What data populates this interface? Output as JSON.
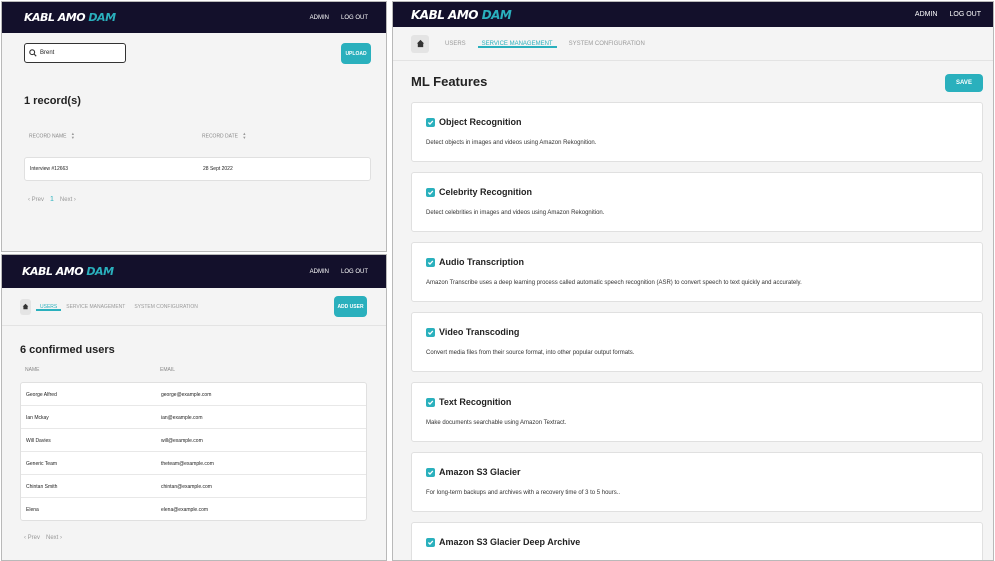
{
  "app": {
    "logo_main": "KABL AMO",
    "logo_accent": "DAM"
  },
  "nav": {
    "admin": "ADMIN",
    "logout": "LOG OUT"
  },
  "records_view": {
    "search_value": "Brent",
    "upload_label": "UPLOAD",
    "count_text": "1 record(s)",
    "columns": {
      "name": "RECORD NAME",
      "date": "RECORD DATE"
    },
    "rows": [
      {
        "name": "Interview #12663",
        "date": "28 Sept 2022"
      }
    ],
    "pagination": {
      "prev": "Prev",
      "page": "1",
      "next": "Next"
    }
  },
  "users_view": {
    "tabs": {
      "users": "USERS",
      "service": "SERVICE MANAGEMENT",
      "system": "SYSTEM CONFIGURATION"
    },
    "add_user_label": "ADD USER",
    "title": "6 confirmed users",
    "columns": {
      "name": "NAME",
      "email": "EMAIL"
    },
    "rows": [
      {
        "name": "George Alfred",
        "email": "george@example.com"
      },
      {
        "name": "Ian Mckay",
        "email": "ian@example.com"
      },
      {
        "name": "Will Davies",
        "email": "will@example.com"
      },
      {
        "name": "Generic Team",
        "email": "theteam@example.com"
      },
      {
        "name": "Chintan Smith",
        "email": "chintan@example.com"
      },
      {
        "name": "Elena",
        "email": "elena@example.com"
      }
    ],
    "pagination": {
      "prev": "Prev",
      "next": "Next"
    }
  },
  "service_view": {
    "tabs": {
      "users": "USERS",
      "service": "SERVICE MANAGEMENT",
      "system": "SYSTEM CONFIGURATION"
    },
    "title": "ML Features",
    "save_label": "SAVE",
    "features": [
      {
        "title": "Object Recognition",
        "desc": "Detect objects in images and videos using Amazon Rekognition.",
        "checked": true
      },
      {
        "title": "Celebrity Recognition",
        "desc": "Detect celebrities in images and videos using Amazon Rekognition.",
        "checked": true
      },
      {
        "title": "Audio Transcription",
        "desc": "Amazon Transcribe uses a deep learning process called automatic speech recognition (ASR) to convert speech to text quickly and accurately.",
        "checked": true
      },
      {
        "title": "Video Transcoding",
        "desc": "Convert media files from their source format, into other popular output formats.",
        "checked": true
      },
      {
        "title": "Text Recognition",
        "desc": "Make documents searchable using Amazon Textract.",
        "checked": true
      },
      {
        "title": "Amazon S3 Glacier",
        "desc": "For long-term backups and archives with a recovery time of 3 to 5 hours..",
        "checked": true
      },
      {
        "title": "Amazon S3 Glacier Deep Archive",
        "desc": "",
        "checked": true
      }
    ]
  },
  "colors": {
    "navbar": "#13102b",
    "accent": "#2ab0bd",
    "background": "#f4f4f4"
  }
}
